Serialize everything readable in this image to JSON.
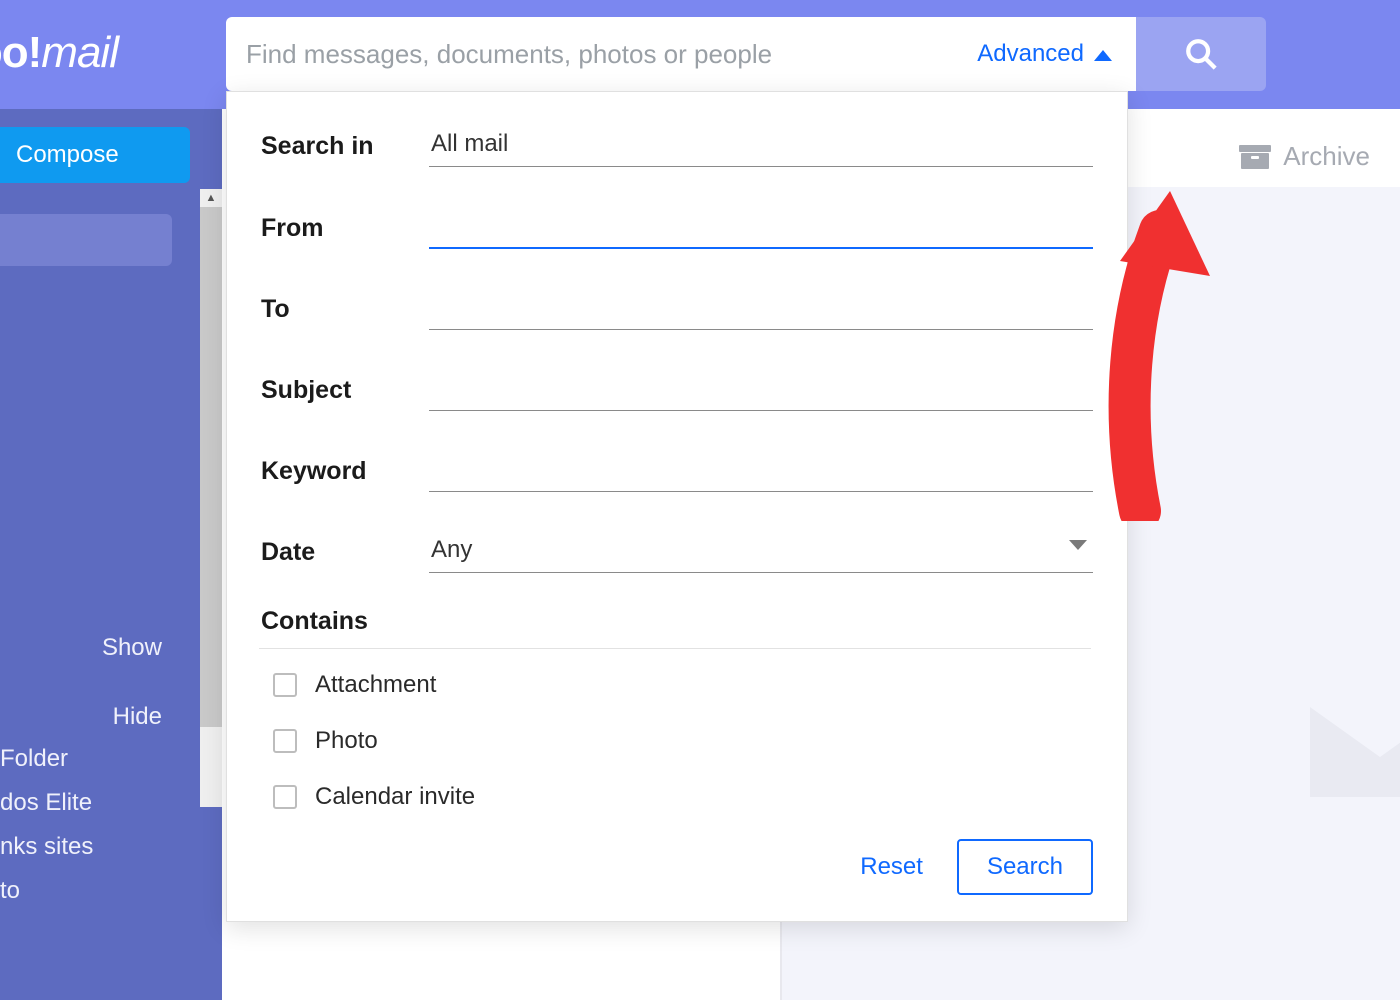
{
  "brand": {
    "left": "hoo!",
    "right": "mail"
  },
  "search": {
    "placeholder": "Find messages, documents, photos or people",
    "advanced_label": "Advanced"
  },
  "toolbar": {
    "archive": "Archive"
  },
  "sidebar": {
    "compose": "Compose",
    "show": "Show",
    "hide": "Hide",
    "folders": [
      "Folder",
      "dos Elite",
      "nks sites",
      "to"
    ]
  },
  "adv": {
    "labels": {
      "search_in": "Search in",
      "from": "From",
      "to": "To",
      "subject": "Subject",
      "keyword": "Keyword",
      "date": "Date",
      "contains": "Contains"
    },
    "search_in_value": "All mail",
    "date_value": "Any",
    "contains_options": [
      "Attachment",
      "Photo",
      "Calendar invite"
    ],
    "reset": "Reset",
    "search": "Search"
  }
}
